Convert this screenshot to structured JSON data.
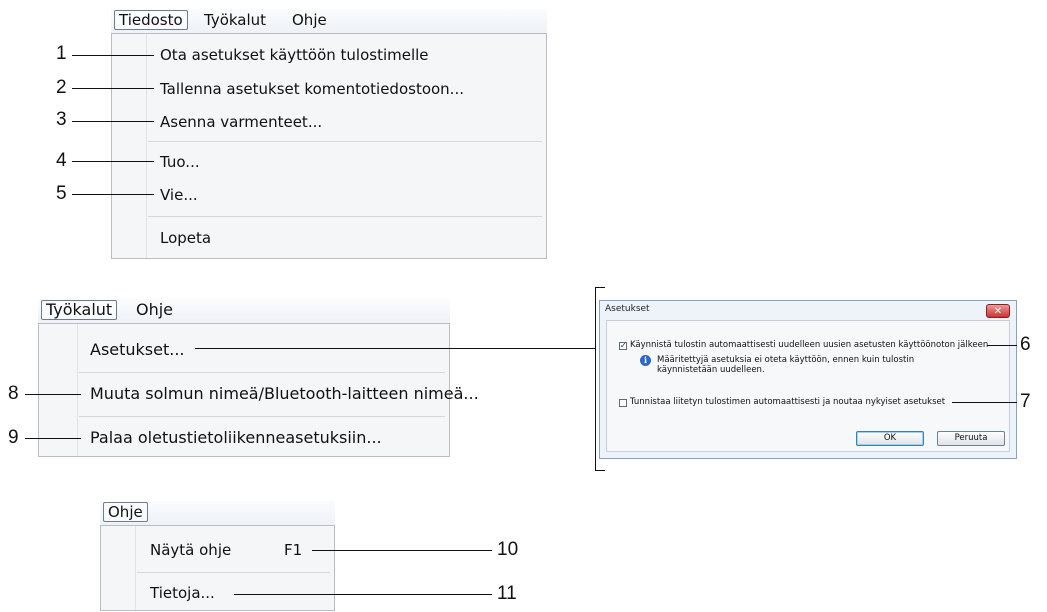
{
  "menu1": {
    "bar": {
      "file": "Tiedosto",
      "tools": "Työkalut",
      "help": "Ohje"
    },
    "items": [
      "Ota asetukset käyttöön tulostimelle",
      "Tallenna asetukset komentotiedostoon...",
      "Asenna varmenteet...",
      "Tuo...",
      "Vie...",
      "Lopeta"
    ],
    "callouts": [
      "1",
      "2",
      "3",
      "4",
      "5"
    ]
  },
  "menu2": {
    "bar": {
      "tools": "Työkalut",
      "help": "Ohje"
    },
    "items": [
      "Asetukset...",
      "Muuta solmun nimeä/Bluetooth-laitteen nimeä...",
      "Palaa oletustietoliikenneasetuksiin..."
    ],
    "callouts": [
      "8",
      "9"
    ]
  },
  "dialog": {
    "title": "Asetukset",
    "close_glyph": "✕",
    "checkbox1_label": "Käynnistä tulostin automaattisesti uudelleen uusien asetusten käyttöönoton jälkeen",
    "checkbox1_checked": true,
    "info_line1": "Määritettyjä asetuksia ei oteta käyttöön, ennen kuin tulostin",
    "info_line2": "käynnistetään uudelleen.",
    "checkbox2_label": "Tunnistaa liitetyn tulostimen automaattisesti ja noutaa nykyiset asetukset",
    "checkbox2_checked": false,
    "ok_label": "OK",
    "cancel_label": "Peruuta",
    "callouts": [
      "6",
      "7"
    ]
  },
  "menu3": {
    "bar": {
      "help": "Ohje"
    },
    "items": [
      {
        "label": "Näytä ohje",
        "shortcut": "F1"
      },
      {
        "label": "Tietoja..."
      }
    ],
    "callouts": [
      "10",
      "11"
    ]
  }
}
